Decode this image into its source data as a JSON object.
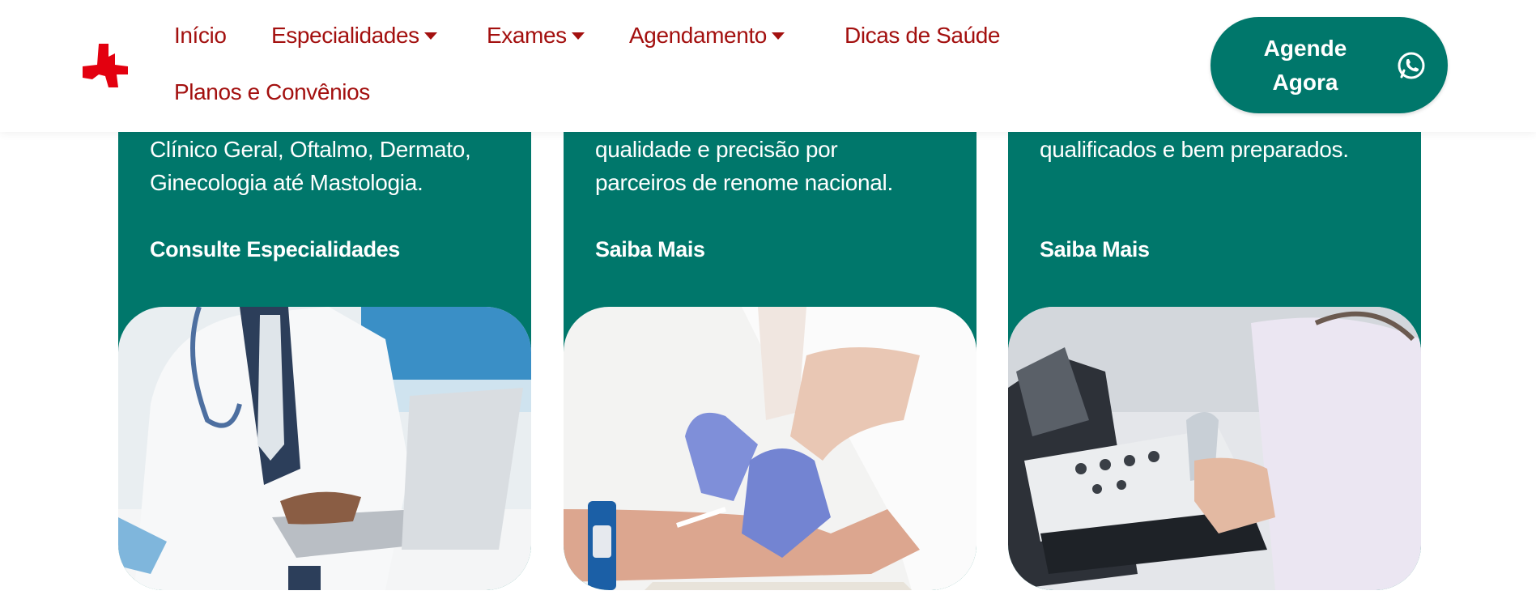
{
  "header": {
    "nav": [
      {
        "label": "Início",
        "dropdown": false
      },
      {
        "label": "Especialidades",
        "dropdown": true
      },
      {
        "label": "Exames",
        "dropdown": true
      },
      {
        "label": "Agendamento",
        "dropdown": true
      },
      {
        "label": "Dicas de Saúde",
        "dropdown": false
      },
      {
        "label": "Planos e Convênios",
        "dropdown": false
      }
    ],
    "cta": {
      "line1": "Agende",
      "line2": "Agora",
      "icon": "whatsapp-icon"
    },
    "logo_icon": "medical-cross-logo"
  },
  "cards": [
    {
      "desc_line1": "Clínico Geral, Oftalmo, Dermato,",
      "desc_line2": "Ginecologia até Mastologia.",
      "link": "Consulte Especialidades",
      "image": "doctor-at-laptop-photo"
    },
    {
      "desc_line1": "qualidade e precisão por",
      "desc_line2": "parceiros de renome nacional.",
      "link": "Saiba Mais",
      "image": "blood-draw-photo"
    },
    {
      "desc_line1": "qualificados e bem preparados.",
      "desc_line2": "",
      "link": "Saiba Mais",
      "image": "ultrasound-exam-photo"
    }
  ],
  "colors": {
    "brand_green": "#00776b",
    "brand_red": "#a3100f",
    "logo_red": "#e3000f"
  }
}
